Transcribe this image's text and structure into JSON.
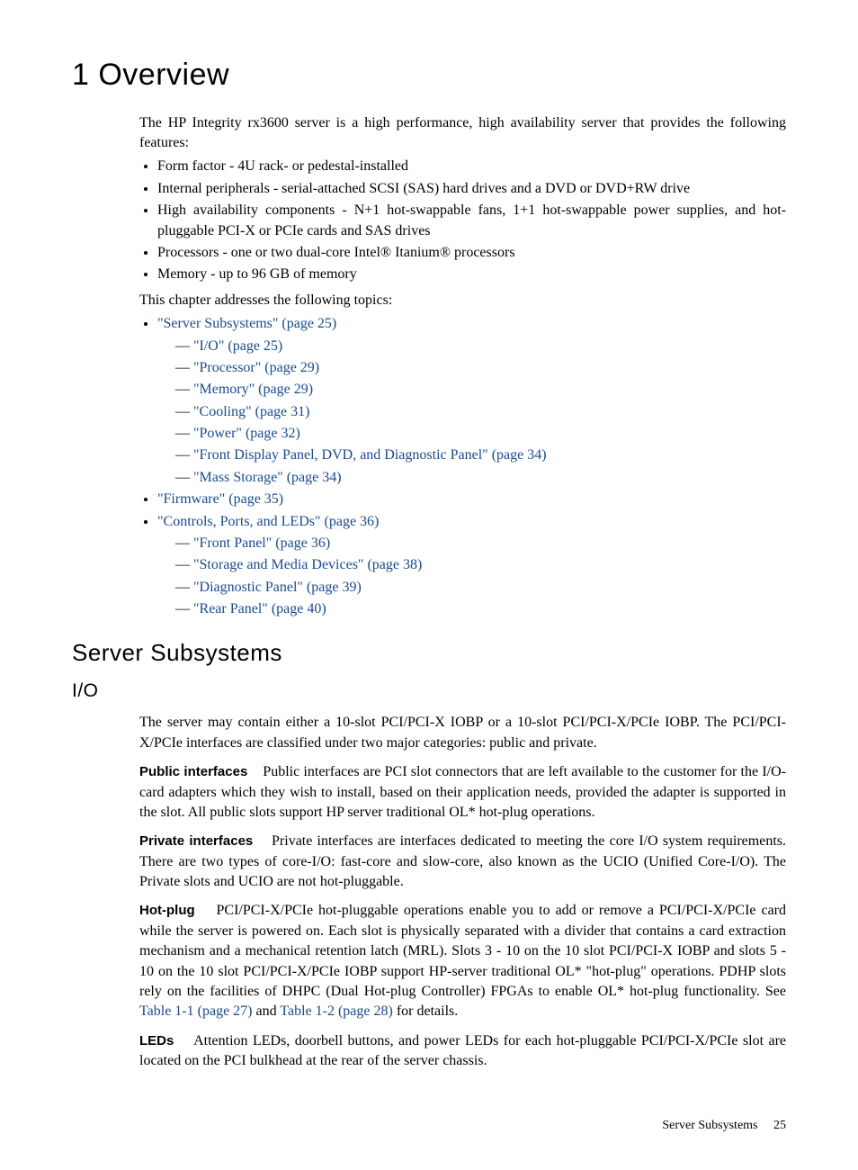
{
  "chapter": {
    "title": "1 Overview"
  },
  "intro": "The HP Integrity rx3600 server is a high performance, high availability server that provides the following features:",
  "features": [
    "Form factor - 4U rack- or pedestal-installed",
    "Internal peripherals - serial-attached SCSI (SAS) hard drives and a DVD or DVD+RW drive",
    "High availability components - N+1 hot-swappable fans, 1+1 hot-swappable power supplies, and hot-pluggable PCI-X or PCIe cards and SAS drives",
    "Processors - one or two dual-core Intel® Itanium® processors",
    "Memory - up to 96 GB of memory"
  ],
  "transition": "This chapter addresses the following topics:",
  "topics": {
    "t0": {
      "label": "\"Server Subsystems\" (page 25)"
    },
    "t0sub": [
      "\"I/O\" (page 25)",
      "\"Processor\" (page 29)",
      "\"Memory\" (page 29)",
      "\"Cooling\" (page 31)",
      "\"Power\" (page 32)",
      "\"Front Display Panel, DVD, and Diagnostic Panel\" (page 34)",
      "\"Mass Storage\" (page 34)"
    ],
    "t1": {
      "label": "\"Firmware\" (page 35)"
    },
    "t2": {
      "label": "\"Controls, Ports, and LEDs\" (page 36)"
    },
    "t2sub": [
      "\"Front Panel\" (page 36)",
      "\"Storage and Media Devices\" (page 38)",
      "\"Diagnostic Panel\" (page 39)",
      "\"Rear Panel\" (page 40)"
    ]
  },
  "section1": {
    "title": "Server Subsystems"
  },
  "section2": {
    "title": "I/O"
  },
  "io_intro": "The server may contain either a 10-slot PCI/PCI-X IOBP or a 10-slot PCI/PCI-X/PCIe IOBP. The PCI/PCI-X/PCIe interfaces are classified under two major categories: public and private.",
  "public": {
    "head": "Public interfaces",
    "body": "Public interfaces are PCI slot connectors that are left available to the customer for the I/O-card adapters which they wish to install, based on their application needs, provided the adapter is supported in the slot. All public slots support HP server traditional OL* hot-plug operations."
  },
  "private": {
    "head": "Private interfaces",
    "body": "Private interfaces are interfaces dedicated to meeting the core I/O system requirements. There are two types of core-I/O: fast-core and slow-core, also known as the UCIO (Unified Core-I/O). The Private slots and UCIO are not hot-pluggable."
  },
  "hotplug": {
    "head": "Hot-plug",
    "body1": "PCI/PCI-X/PCIe hot-pluggable operations enable you to add or remove a PCI/PCI-X/PCIe card while the server is powered on. Each slot is physically separated with a divider that contains a card extraction mechanism and a mechanical retention latch (MRL). Slots 3 - 10 on the 10 slot PCI/PCI-X IOBP and slots 5 - 10 on the 10 slot PCI/PCI-X/PCIe IOBP support HP-server traditional OL* \"hot-plug\" operations. PDHP slots rely on the facilities of DHPC (Dual Hot-plug Controller) FPGAs to enable OL* hot-plug functionality. See ",
    "link1": "Table 1-1 (page 27)",
    "mid": " and ",
    "link2": "Table 1-2 (page 28)",
    "body2": " for details."
  },
  "leds": {
    "head": "LEDs",
    "body": "Attention LEDs, doorbell buttons, and power LEDs for each hot-pluggable PCI/PCI-X/PCIe slot are located on the PCI bulkhead at the rear of the server chassis."
  },
  "footer": {
    "section": "Server Subsystems",
    "page": "25"
  }
}
